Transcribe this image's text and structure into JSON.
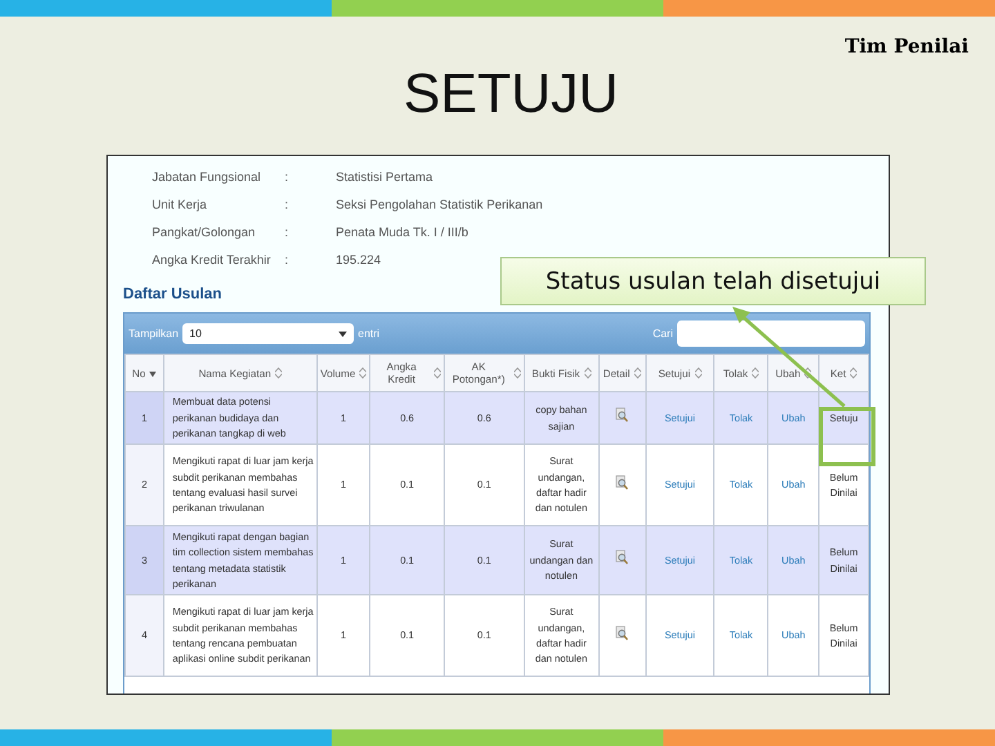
{
  "slide": {
    "title": "SETUJU",
    "role_label": "Tim Penilai"
  },
  "profile": [
    {
      "label": "Jabatan Fungsional",
      "separator": ":",
      "value": "Statistisi Pertama"
    },
    {
      "label": "Unit Kerja",
      "separator": ":",
      "value": "Seksi Pengolahan Statistik Perikanan"
    },
    {
      "label": "Pangkat/Golongan",
      "separator": ":",
      "value": "Penata Muda Tk. I / III/b"
    },
    {
      "label": "Angka Kredit Terakhir",
      "separator": ":",
      "value": "195.224"
    }
  ],
  "section_title": "Daftar Usulan",
  "table_controls": {
    "show_label": "Tampilkan",
    "page_size": "10",
    "entries_label": "entri",
    "search_label": "Cari"
  },
  "table": {
    "columns": [
      {
        "label": "No",
        "sorted": true
      },
      {
        "label": "Nama Kegiatan",
        "sorted": false
      },
      {
        "label": "Volume",
        "sorted": false
      },
      {
        "label": "Angka Kredit",
        "sorted": false
      },
      {
        "label": "AK Potongan*)",
        "sorted": false
      },
      {
        "label": "Bukti Fisik",
        "sorted": false
      },
      {
        "label": "Detail",
        "sorted": false
      },
      {
        "label": "Setujui",
        "sorted": false
      },
      {
        "label": "Tolak",
        "sorted": false
      },
      {
        "label": "Ubah",
        "sorted": false
      },
      {
        "label": "Ket",
        "sorted": false
      }
    ],
    "rows": [
      {
        "no": "1",
        "activity": "Membuat data potensi perikanan budidaya dan perikanan tangkap di web",
        "volume": "1",
        "credit": "0.6",
        "cut": "0.6",
        "evidence": "copy bahan sajian",
        "approve": "Setujui",
        "reject": "Tolak",
        "edit": "Ubah",
        "note": "Setuju"
      },
      {
        "no": "2",
        "activity": "Mengikuti rapat di luar jam kerja subdit perikanan membahas tentang evaluasi hasil survei perikanan triwulanan",
        "volume": "1",
        "credit": "0.1",
        "cut": "0.1",
        "evidence": "Surat undangan, daftar hadir dan notulen",
        "approve": "Setujui",
        "reject": "Tolak",
        "edit": "Ubah",
        "note": "Belum Dinilai"
      },
      {
        "no": "3",
        "activity": "Mengikuti rapat dengan bagian tim collection sistem membahas tentang metadata statistik perikanan",
        "volume": "1",
        "credit": "0.1",
        "cut": "0.1",
        "evidence": "Surat undangan dan notulen",
        "approve": "Setujui",
        "reject": "Tolak",
        "edit": "Ubah",
        "note": "Belum Dinilai"
      },
      {
        "no": "4",
        "activity": "Mengikuti rapat di luar jam kerja subdit perikanan membahas tentang rencana pembuatan aplikasi online subdit perikanan",
        "volume": "1",
        "credit": "0.1",
        "cut": "0.1",
        "evidence": "Surat undangan, daftar hadir dan notulen",
        "approve": "Setujui",
        "reject": "Tolak",
        "edit": "Ubah",
        "note": "Belum Dinilai"
      }
    ]
  },
  "callout": "Status usulan telah disetujui"
}
